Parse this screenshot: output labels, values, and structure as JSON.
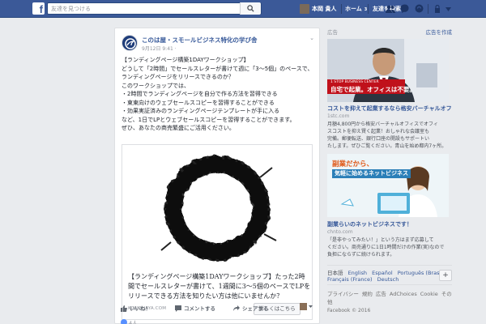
{
  "topbar": {
    "logo": "f",
    "search_placeholder": "友達を見つける",
    "user_name": "本岡 貴人",
    "home_label": "ホーム",
    "home_count": "3",
    "find_friends_label": "友達を検索"
  },
  "post": {
    "page_name": "このは屋・スモールビジネス特化の学び舎",
    "meta": "9月12日 9:41 ·",
    "menu": "⌄",
    "lines": [
      "【ランディングページ構築1DAYワークショップ】",
      "どうして「2時間」でセールスレターが書けて週に「3〜5個」のペースで、",
      "ランディングページをリリースできるのか？",
      "このワークショップでは、",
      "・2時間でランディングページを自分で作る方法を習得できる",
      "・東東向けのウェブセールスコピーを習得することができる",
      "・効果実証済みのランディングページテンプレートが手に入る",
      "など、1日でLPとウェブセールスコピーを習得することができます。",
      "ぜひ、あなたの商売繁盛にご活用ください。"
    ],
    "link": {
      "title": "【ランディングページ構築1DAYワークショップ】たった2時間でセールスレターが書けて、1週間に3〜5個のペースでLPをリリースできる方法を知りたい方は他にいませんか？",
      "domain": "KONOHAYA.COM",
      "button": "詳しくはこちら"
    },
    "actions": {
      "like": "いいね！",
      "comment": "コメントする",
      "share": "シェアする"
    },
    "likes_count": "4人"
  },
  "sidebar": {
    "ads_heading": "広告",
    "create_ad": "広告を作成",
    "ads": [
      {
        "banner_line1": "1 STOP BUSINESS CENTER",
        "banner_line2": "自宅で起業。オフィスは不要。",
        "title": "コストを抑えて起業するなら格安バーチャルオフ...",
        "domain": "1stc.com",
        "desc": [
          "月額4,800円から格安バーチャルオフィスでオフィ",
          "スコストを抑え賢く起業！おしゃれな会議室も",
          "完備。郵便転送、銀行口座の開設もサポートい",
          "たします。ぜひご覧ください。青山を始め都内7ヶ所。"
        ]
      },
      {
        "banner_line1": "副業だから、",
        "banner_line2": "気軽に始めるネットビジネス",
        "title": "副業らいのネットビジネスです！",
        "domain": "chnto.com",
        "desc": [
          "「是非やってみたい！」という方はまず応募して",
          "ください。商売通りに1日1時間だけの作業(実)なので",
          "負担にならずに続けられます。"
        ]
      }
    ],
    "languages": [
      "日本語",
      "English",
      "Español",
      "Português (Brasil)",
      "Français (France)",
      "Deutsch"
    ],
    "lang_add": "+",
    "footer_links": [
      "プライバシー",
      "規約",
      "広告",
      "AdChoices",
      "Cookie",
      "その他"
    ],
    "copyright": "Facebook © 2016"
  }
}
